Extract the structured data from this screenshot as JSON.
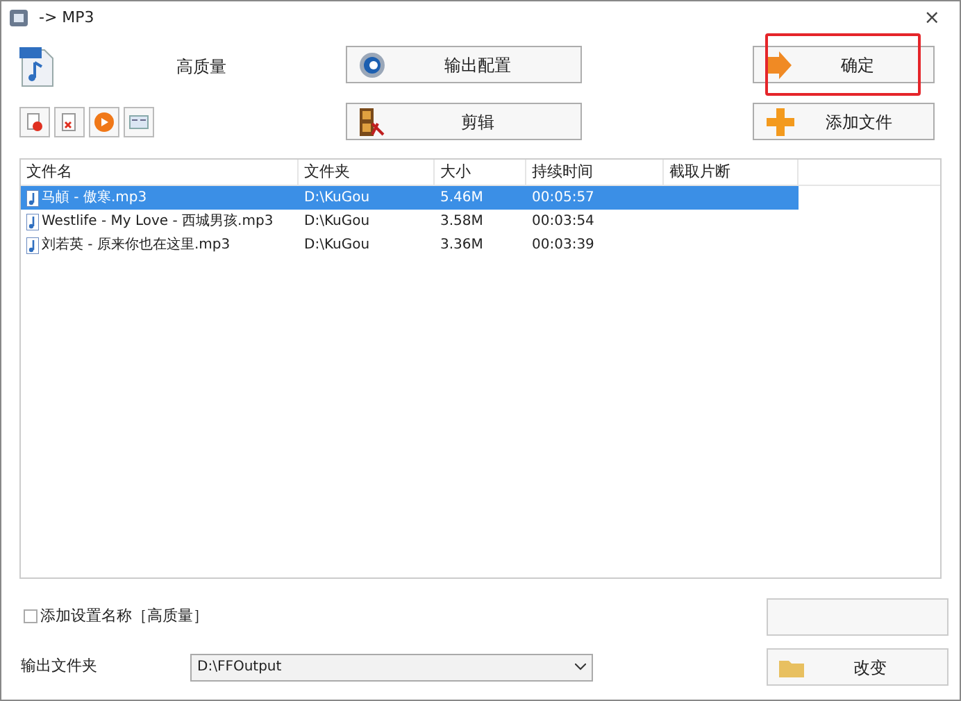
{
  "window": {
    "title": "-> MP3",
    "close": "×"
  },
  "profile": {
    "label": "高质量"
  },
  "buttons": [
    {
      "kind": "config",
      "label": "输出配置"
    },
    {
      "kind": "clip",
      "label": "剪辑"
    },
    {
      "kind": "ok",
      "label": "确定",
      "highlighted": true
    },
    {
      "kind": "add",
      "label": "添加文件"
    }
  ],
  "table": {
    "columns": [
      "文件名",
      "文件夹",
      "大小",
      "持续时间",
      "截取片断"
    ],
    "rows": [
      {
        "cells": [
          "马頔 - 傲寒.mp3",
          "D:\\KuGou",
          "5.46M",
          "00:05:57",
          ""
        ],
        "selected": true
      },
      {
        "cells": [
          "Westlife - My Love - 西城男孩.mp3",
          "D:\\KuGou",
          "3.58M",
          "00:03:54",
          ""
        ],
        "selected": false
      },
      {
        "cells": [
          "刘若英 - 原来你也在这里.mp3",
          "D:\\KuGou",
          "3.36M",
          "00:03:39",
          ""
        ],
        "selected": false
      }
    ]
  },
  "add_name_option": {
    "label": "添加设置名称［高质量］",
    "checked": false
  },
  "output_folder": {
    "label": "输出文件夹",
    "value": "D:\\FFOutput",
    "change_button": "改变"
  }
}
